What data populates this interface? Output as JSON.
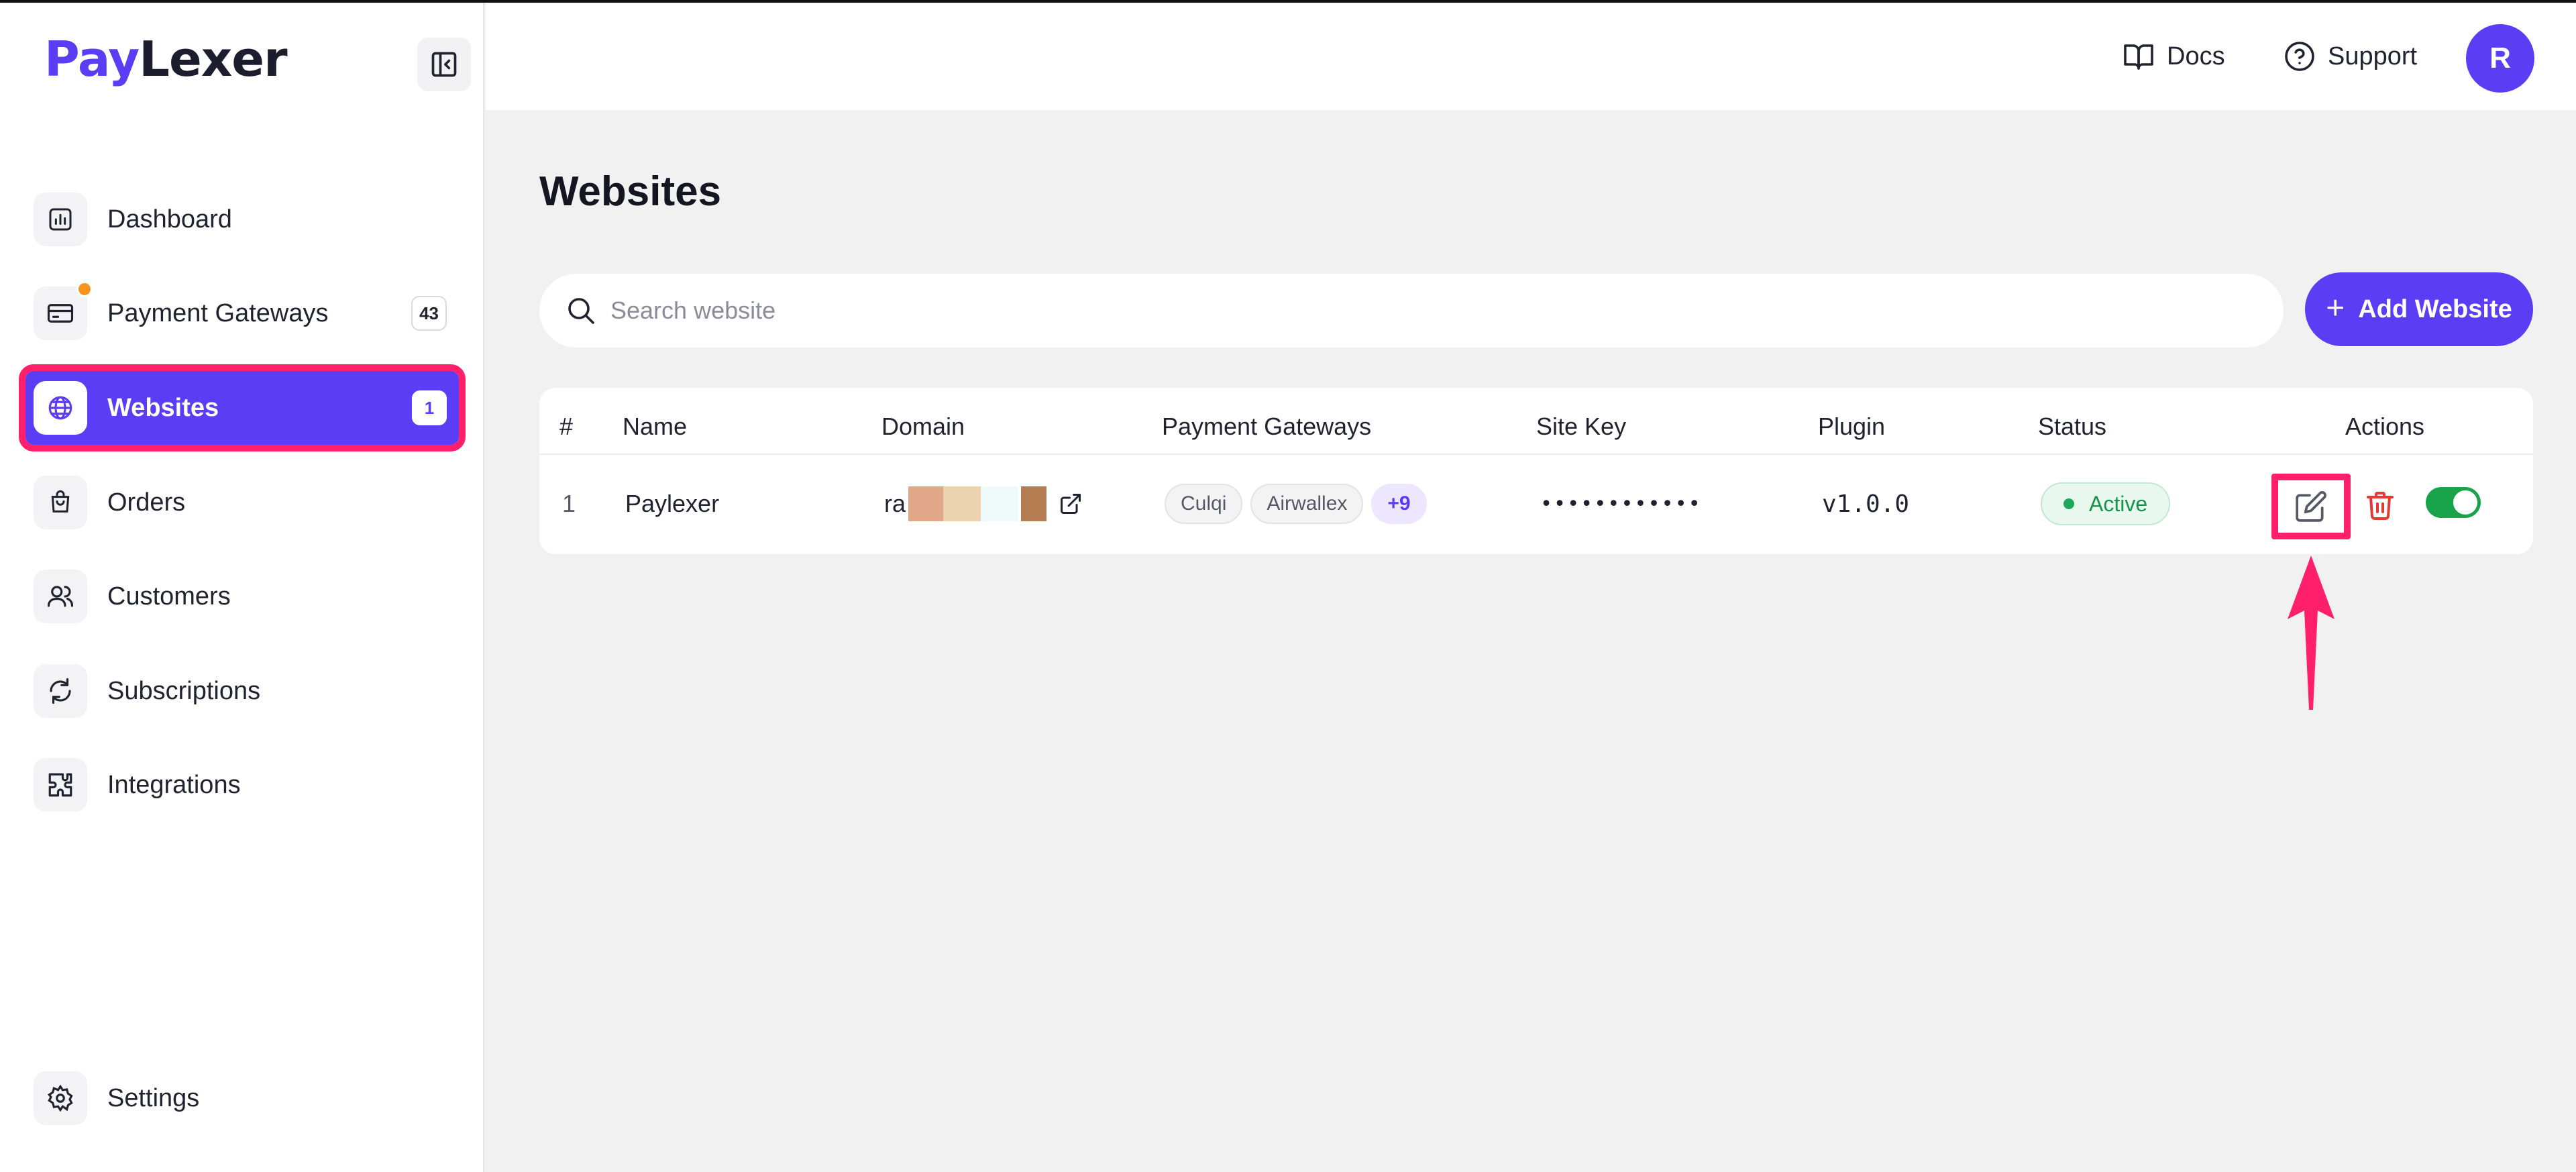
{
  "brand": {
    "pay": "Pay",
    "lexer": "Lexer"
  },
  "sidebar": {
    "items": [
      {
        "label": "Dashboard",
        "icon": "chart-icon"
      },
      {
        "label": "Payment Gateways",
        "icon": "card-icon",
        "badge": "43",
        "notification": true
      },
      {
        "label": "Websites",
        "icon": "globe-icon",
        "badge": "1",
        "active": true
      },
      {
        "label": "Orders",
        "icon": "bag-icon"
      },
      {
        "label": "Customers",
        "icon": "users-icon"
      },
      {
        "label": "Subscriptions",
        "icon": "refresh-icon"
      },
      {
        "label": "Integrations",
        "icon": "puzzle-icon"
      }
    ],
    "settings_label": "Settings"
  },
  "header": {
    "docs_label": "Docs",
    "support_label": "Support",
    "avatar_initial": "R"
  },
  "main": {
    "title": "Websites",
    "search_placeholder": "Search website",
    "add_button_label": "Add Website",
    "table": {
      "columns": [
        "#",
        "Name",
        "Domain",
        "Payment Gateways",
        "Site Key",
        "Plugin",
        "Status",
        "Actions"
      ],
      "rows": [
        {
          "index": "1",
          "name": "Paylexer",
          "domain_prefix": "ra",
          "gateways": [
            "Culqi",
            "Airwallex"
          ],
          "gateways_more": "+9",
          "site_key": "••••••••••••",
          "plugin": "v1.0.0",
          "status": "Active"
        }
      ]
    }
  },
  "colors": {
    "accent": "#5b3df5",
    "highlight": "#ff1f6a",
    "active_green": "#19a44b",
    "delete_red": "#e53935"
  }
}
